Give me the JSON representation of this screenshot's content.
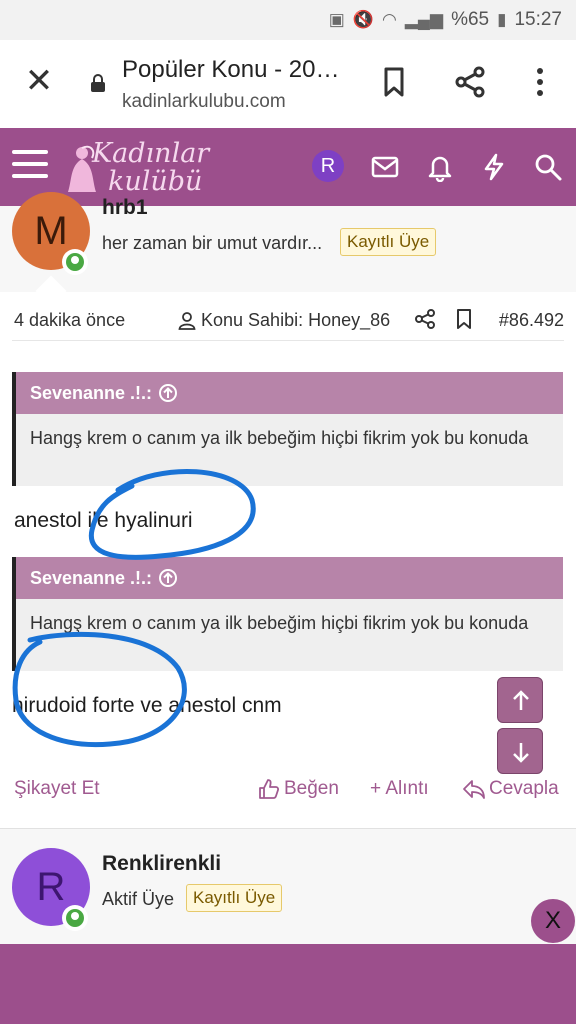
{
  "status_bar": {
    "battery": "%65",
    "time": "15:27"
  },
  "browser": {
    "tab_title": "Popüler Konu - 20…",
    "url": "kadinlarkulubu.com"
  },
  "site": {
    "logo_line1": "Kadınlar",
    "logo_line2": "kulübü",
    "user_initial": "R",
    "accent_color": "#9c4f8c"
  },
  "post": {
    "author_initial": "M",
    "author_name": "hrb1",
    "author_title": "her zaman bir umut vardır...",
    "author_badge": "Kayıtlı Üye",
    "time": "4 dakika önce",
    "owner_label": "Konu Sahibi: Honey_86",
    "number": "#86.492",
    "quotes": [
      {
        "author": "Sevenanne .!.:",
        "text": "Hangş krem o canım ya ilk bebeğim hiçbi fikrim yok bu konuda"
      },
      {
        "author": "Sevenanne .!.:",
        "text": "Hangş krem o canım ya ilk bebeğim hiçbi fikrim yok bu konuda"
      }
    ],
    "replies": [
      "anestol ile hyalinuri",
      "hirudoid forte ve anestol cnm"
    ],
    "actions": {
      "report": "Şikayet Et",
      "like": "Beğen",
      "quote": "+ Alıntı",
      "reply": "Cevapla"
    }
  },
  "next_post": {
    "author_initial": "R",
    "author_name": "Renklirenkli",
    "author_title": "Aktif Üye",
    "author_badge": "Kayıtlı Üye"
  },
  "overlay": {
    "close_label": "X"
  }
}
